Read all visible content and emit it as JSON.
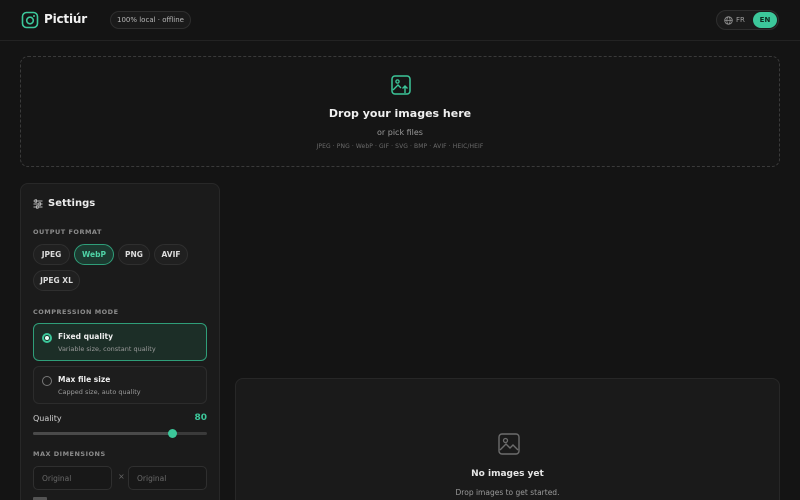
{
  "header": {
    "app_name": "Pictiúr",
    "badge": "100% local · offline",
    "lang_fr": "FR",
    "lang_en": "EN",
    "accent_color": "#3cc79a"
  },
  "dropzone": {
    "title": "Drop your images here",
    "pick": "or pick files",
    "formats": "JPEG · PNG · WebP · GIF · SVG · BMP · AVIF · HEIC/HEIF",
    "icon": "image-upload-icon"
  },
  "settings": {
    "title": "Settings",
    "icon": "sliders-icon",
    "output_format_label": "OUTPUT FORMAT",
    "formats": [
      "JPEG",
      "WebP",
      "PNG",
      "AVIF",
      "JPEG XL"
    ],
    "selected_format": "WebP",
    "compression_label": "COMPRESSION MODE",
    "modes": [
      {
        "title": "Fixed quality",
        "subtitle": "Variable size, constant quality",
        "selected": true
      },
      {
        "title": "Max file size",
        "subtitle": "Capped size, auto quality",
        "selected": false
      }
    ],
    "quality_label": "Quality",
    "quality_value": "80",
    "quality_fraction": 0.8,
    "max_dimensions_label": "MAX DIMENSIONS",
    "width_placeholder": "Original",
    "height_placeholder": "Original",
    "dimension_separator": "×"
  },
  "empty_state": {
    "title": "No images yet",
    "subtitle": "Drop images to get started.",
    "icon": "image-icon"
  }
}
